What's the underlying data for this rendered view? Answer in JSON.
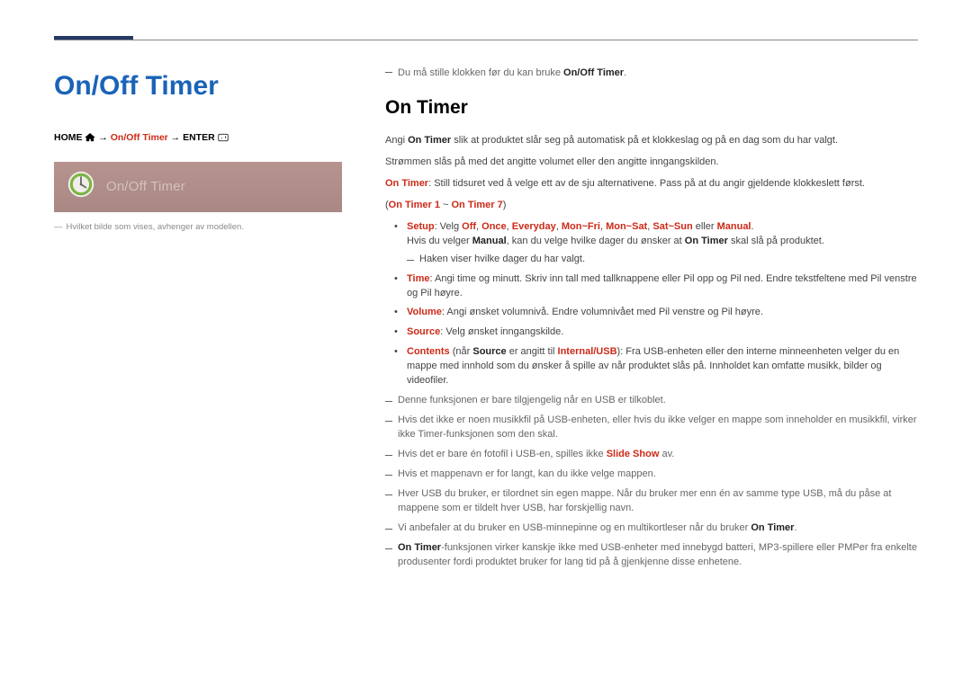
{
  "heading": "On/Off Timer",
  "breadcrumb": {
    "part1": "HOME",
    "part2": "On/Off Timer",
    "part3": "ENTER"
  },
  "panel": {
    "iconName": "timer-icon",
    "label": "On/Off Timer"
  },
  "leftNote": "Hvilket bilde som vises, avhenger av modellen.",
  "topNoteA": "Du må stille klokken før du kan bruke ",
  "topNoteB": "On/Off Timer",
  "topNoteC": ".",
  "h2": "On Timer",
  "p1a": "Angi ",
  "p1b": "On Timer",
  "p1c": " slik at produktet slår seg på automatisk på et klokkeslag og på en dag som du har valgt.",
  "p2": "Strømmen slås på med det angitte volumet eller den angitte inngangskilden.",
  "p3a": "On Timer",
  "p3b": ": Still tidsuret ved å velge ett av de sju alternativene. Pass på at du angir gjeldende klokkeslett først.",
  "p4": "(On Timer 1 ~ On Timer 7)",
  "bullets": {
    "b1": {
      "label": "Setup",
      "mid1": ": Velg ",
      "opt1": "Off",
      "opt2": "Once",
      "opt3": "Everyday",
      "opt4": "Mon~Fri",
      "opt5": "Mon~Sat",
      "opt6": "Sat~Sun",
      "mid2": " eller ",
      "opt7": "Manual",
      "end": ".",
      "line2a": "Hvis du velger ",
      "line2b": "Manual",
      "line2c": ", kan du velge hvilke dager du ønsker at ",
      "line2d": "On Timer",
      "line2e": " skal slå på produktet.",
      "sub": "Haken viser hvilke dager du har valgt."
    },
    "b2": {
      "label": "Time",
      "text": ": Angi time og minutt. Skriv inn tall med tallknappene eller Pil opp og Pil ned. Endre tekstfeltene med Pil venstre og Pil høyre."
    },
    "b3": {
      "label": "Volume",
      "text": ": Angi ønsket volumnivå. Endre volumnivået med Pil venstre og Pil høyre."
    },
    "b4": {
      "label": "Source",
      "text": ": Velg ønsket inngangskilde."
    },
    "b5": {
      "label": "Contents",
      "mid1": " (når ",
      "src": "Source",
      "mid2": " er angitt til ",
      "iu": "Internal/USB",
      "text": "): Fra USB-enheten eller den interne minneenheten velger du en mappe med innhold som du ønsker å spille av når produktet slås på. Innholdet kan omfatte musikk, bilder og videofiler."
    }
  },
  "dashNotes": {
    "d1": "Denne funksjonen er bare tilgjengelig når en USB er tilkoblet.",
    "d2": "Hvis det ikke er noen musikkfil på USB-enheten, eller hvis du ikke velger en mappe som inneholder en musikkfil, virker ikke Timer-funksjonen som den skal.",
    "d3a": "Hvis det er bare én fotofil i USB-en, spilles ikke ",
    "d3b": "Slide Show",
    "d3c": " av.",
    "d4": "Hvis et mappenavn er for langt, kan du ikke velge mappen.",
    "d5": "Hver USB du bruker, er tilordnet sin egen mappe. Når du bruker mer enn én av samme type USB, må du påse at mappene som er tildelt hver USB, har forskjellig navn.",
    "d6a": "Vi anbefaler at du bruker en USB-minnepinne og en multikortleser når du bruker ",
    "d6b": "On Timer",
    "d6c": ".",
    "d7a": "On Timer",
    "d7b": "-funksjonen virker kanskje ikke med USB-enheter med innebygd batteri, MP3-spillere eller PMPer fra enkelte produsenter fordi produktet bruker for lang tid på å gjenkjenne disse enhetene."
  }
}
